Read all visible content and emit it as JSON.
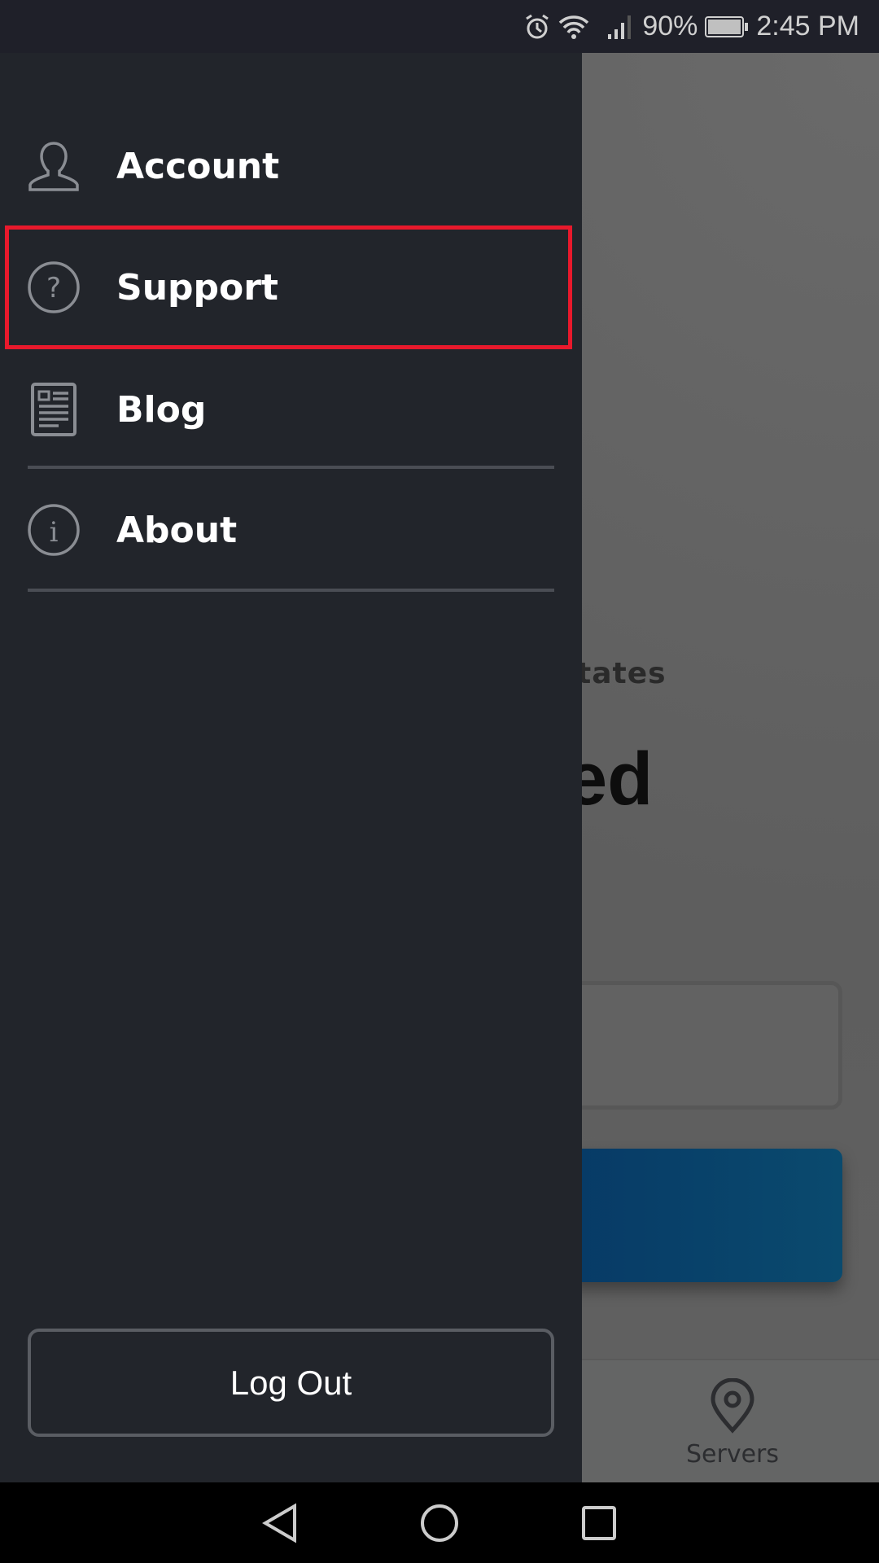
{
  "status_bar": {
    "battery": "90%",
    "time": "2:45 PM",
    "icons": [
      "alarm-icon",
      "wifi-icon",
      "signal-icon",
      "battery-icon"
    ]
  },
  "drawer": {
    "items": [
      {
        "label": "Account",
        "icon": "user-icon"
      },
      {
        "label": "Support",
        "icon": "question-circle-icon",
        "highlighted": true
      },
      {
        "label": "Blog",
        "icon": "newspaper-icon"
      },
      {
        "label": "About",
        "icon": "info-circle-icon"
      }
    ],
    "logout_label": "Log Out",
    "highlight_color": "#e8192c"
  },
  "background": {
    "location_partial": "tates",
    "status_partial": "ed",
    "bottom_nav": {
      "servers_label": "Servers",
      "icon": "map-pin-icon"
    }
  },
  "nav_bar": {
    "icons": [
      "back-icon",
      "home-icon",
      "recents-icon"
    ]
  }
}
